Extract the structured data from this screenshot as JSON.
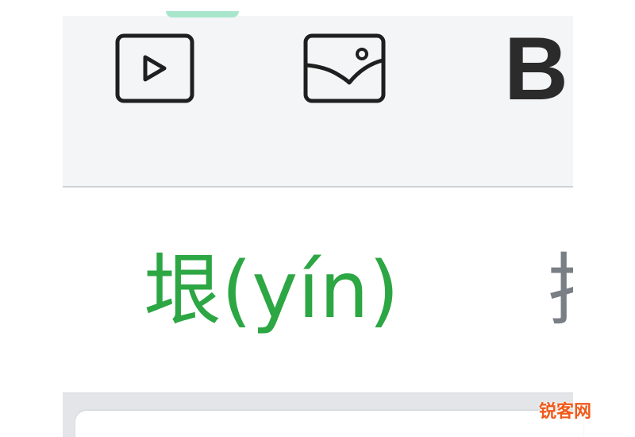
{
  "toolbar": {
    "video_icon": "play-box-icon",
    "image_icon": "image-icon",
    "bold_label": "B"
  },
  "content": {
    "word": "垠(yín)",
    "next_char": "拉"
  },
  "watermark": {
    "text": "锐客网"
  },
  "colors": {
    "toolbar_bg": "#f4f5f7",
    "accent_green": "#2da644",
    "tab_indicator": "#a8e6cc",
    "icon_dark": "#1f1f1f",
    "gray_text": "#7a7f86",
    "watermark": "#f05a1a"
  }
}
